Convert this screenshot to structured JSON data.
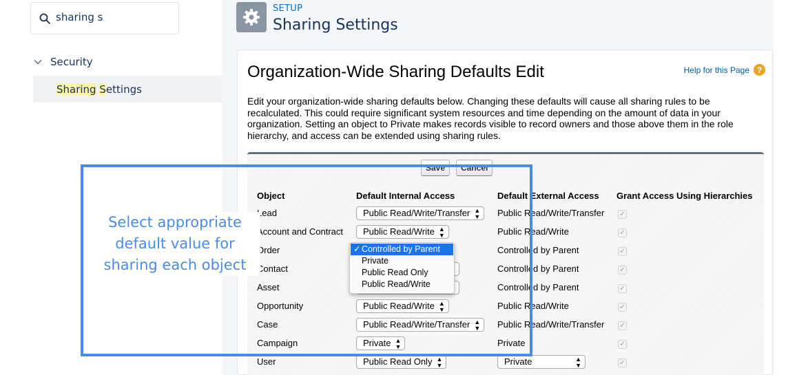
{
  "sidebar": {
    "search": {
      "value": "sharing s"
    },
    "tree": {
      "security_label": "Security",
      "item": {
        "pre": "Sharing",
        "sep": " ",
        "hl": "S",
        "post": "ettings"
      }
    }
  },
  "header": {
    "kicker": "SETUP",
    "title": "Sharing Settings",
    "icon": "gear-icon"
  },
  "page": {
    "title": "Organization-Wide Sharing Defaults Edit",
    "help_label": "Help for this Page",
    "help_icon": "?",
    "intro": "Edit your organization-wide sharing defaults below. Changing these defaults will cause all sharing rules to be recalculated. This could require significant system resources and time depending on the amount of data in your organization. Setting an object to Private makes records visible to record owners and those above them in the role hierarchy, and access can be extended using sharing rules.",
    "buttons": {
      "save": "Save",
      "cancel": "Cancel"
    }
  },
  "table": {
    "headers": [
      "Object",
      "Default Internal Access",
      "Default External Access",
      "Grant Access Using Hierarchies"
    ],
    "rows": [
      {
        "object": "Lead",
        "internal": "Public Read/Write/Transfer",
        "external": "Public Read/Write/Transfer"
      },
      {
        "object": "Account and Contract",
        "internal": "Public Read/Write",
        "external": "Public Read/Write"
      },
      {
        "object": "Order",
        "internal": "Controlled by Parent",
        "external": "Controlled by Parent"
      },
      {
        "object": "Contact",
        "internal": "Controlled by Parent",
        "external": "Controlled by Parent"
      },
      {
        "object": "Asset",
        "internal": "Controlled by Parent",
        "external": "Controlled by Parent"
      },
      {
        "object": "Opportunity",
        "internal": "Public Read/Write",
        "external": "Public Read/Write"
      },
      {
        "object": "Case",
        "internal": "Public Read/Write/Transfer",
        "external": "Public Read/Write/Transfer"
      },
      {
        "object": "Campaign",
        "internal": "Private",
        "external": "Private"
      },
      {
        "object": "User",
        "internal": "Public Read Only",
        "external": "Private"
      }
    ],
    "checkmark": "✓"
  },
  "dropdown": {
    "options": [
      "Controlled by Parent",
      "Private",
      "Public Read Only",
      "Public Read/Write"
    ],
    "selected": "Controlled by Parent",
    "check": "✓"
  },
  "overlay": {
    "text": "Select appropriate default value for sharing each object",
    "color": "#4a8bea"
  },
  "colors": {
    "accent": "#0070d2",
    "title_text": "#16325c",
    "menu_highlight": "#1a73e8"
  }
}
